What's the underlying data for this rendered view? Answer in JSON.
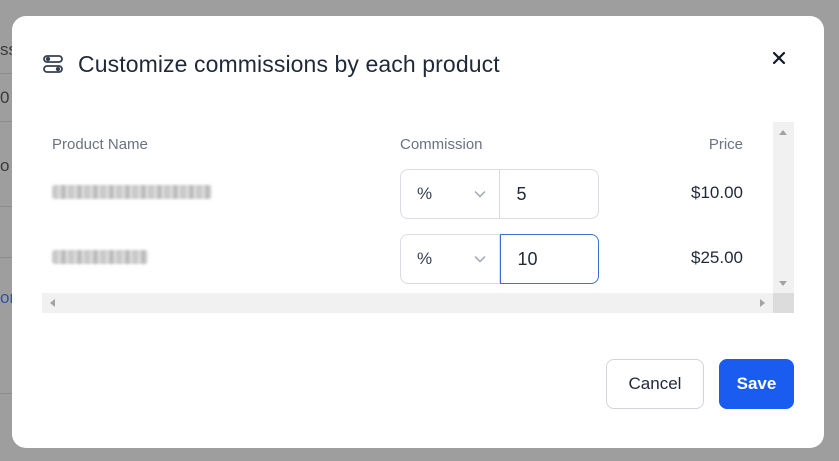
{
  "background": {
    "fragments": [
      "ss",
      "0",
      "o",
      "or"
    ]
  },
  "modal": {
    "title": "Customize commissions by each product",
    "title_icon": "sliders-icon",
    "close_icon": "close-icon"
  },
  "table": {
    "columns": {
      "product_name": "Product Name",
      "commission": "Commission",
      "price": "Price"
    },
    "rows": [
      {
        "unit": "%",
        "value": "5",
        "price": "$10.00"
      },
      {
        "unit": "%",
        "value": "10",
        "price": "$25.00"
      }
    ]
  },
  "footer": {
    "cancel_label": "Cancel",
    "save_label": "Save"
  },
  "colors": {
    "accent": "#1a5cf0",
    "focus_border": "#3b6fd4"
  }
}
